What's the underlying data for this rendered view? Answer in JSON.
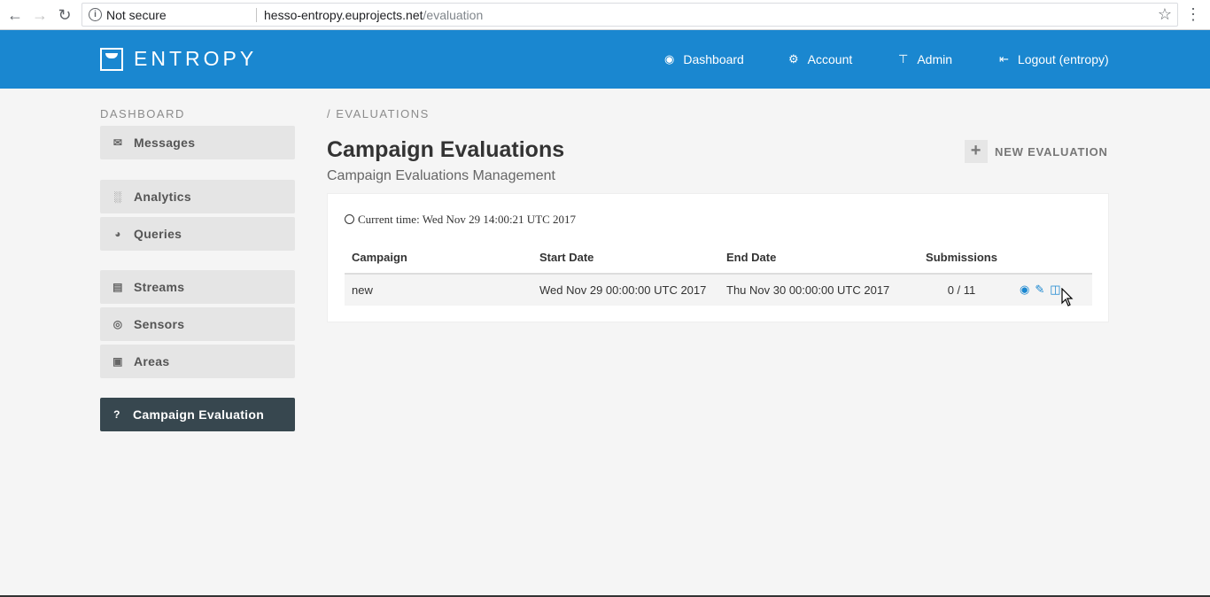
{
  "browser": {
    "security_label": "Not secure",
    "url_host": "hesso-entropy.euprojects.net",
    "url_path": "/evaluation"
  },
  "header": {
    "logo_text": "ENTROPY",
    "nav": [
      {
        "label": "Dashboard",
        "icon": "dashboard-icon"
      },
      {
        "label": "Account",
        "icon": "gear-icon"
      },
      {
        "label": "Admin",
        "icon": "pin-icon"
      },
      {
        "label": "Logout (entropy)",
        "icon": "logout-icon"
      }
    ]
  },
  "sidebar": {
    "title": "DASHBOARD",
    "items": [
      {
        "label": "Messages",
        "icon": "envelope-icon"
      },
      {
        "label": "Analytics",
        "icon": "bar-chart-icon"
      },
      {
        "label": "Queries",
        "icon": "pie-chart-icon"
      },
      {
        "label": "Streams",
        "icon": "list-icon"
      },
      {
        "label": "Sensors",
        "icon": "target-icon"
      },
      {
        "label": "Areas",
        "icon": "map-icon"
      },
      {
        "label": "Campaign Evaluation",
        "icon": "question-icon",
        "active": true
      }
    ]
  },
  "main": {
    "breadcrumb": "/ EVALUATIONS",
    "title": "Campaign Evaluations",
    "subtitle": "Campaign Evaluations Management",
    "new_button": "NEW EVALUATION",
    "current_time": "Current time: Wed Nov 29 14:00:21 UTC 2017",
    "table": {
      "headers": [
        "Campaign",
        "Start Date",
        "End Date",
        "Submissions"
      ],
      "rows": [
        {
          "campaign": "new",
          "start": "Wed Nov 29 00:00:00 UTC 2017",
          "end": "Thu Nov 30 00:00:00 UTC 2017",
          "submissions": "0 / 11"
        }
      ]
    }
  }
}
